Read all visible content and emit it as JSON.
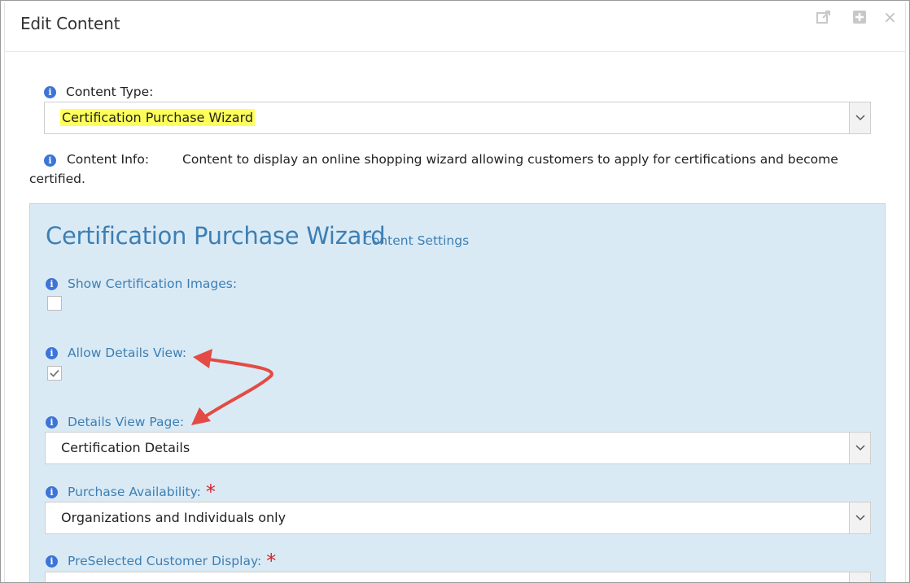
{
  "window": {
    "title": "Edit Content",
    "header_icons": [
      "external-link-icon",
      "plus-square-icon",
      "close-icon"
    ],
    "close_glyph": "×"
  },
  "content_type": {
    "label": "Content Type:",
    "value": "Certification Purchase Wizard"
  },
  "content_info": {
    "label": "Content Info:",
    "text": "Content to display an online shopping wizard allowing customers to apply for certifications and become certified."
  },
  "panel": {
    "title": "Certification Purchase Wizard",
    "subtitle": "Content Settings",
    "fields": {
      "show_images": {
        "label": "Show Certification Images:",
        "checked": false
      },
      "allow_details": {
        "label": "Allow Details View:",
        "checked": true
      },
      "details_page": {
        "label": "Details View Page:",
        "value": "Certification Details"
      },
      "purchase_availability": {
        "label": "Purchase Availability:",
        "required": "*",
        "value": "Organizations and Individuals only"
      },
      "preselected_display": {
        "label": "PreSelected Customer Display:",
        "required": "*"
      }
    }
  },
  "colors": {
    "accent_blue": "#3d7fb3",
    "info_icon": "#3c74d8",
    "panel_bg": "#daeaf5",
    "highlight": "#ffff5a",
    "arrow": "#e34b45",
    "required": "#d8232a"
  }
}
